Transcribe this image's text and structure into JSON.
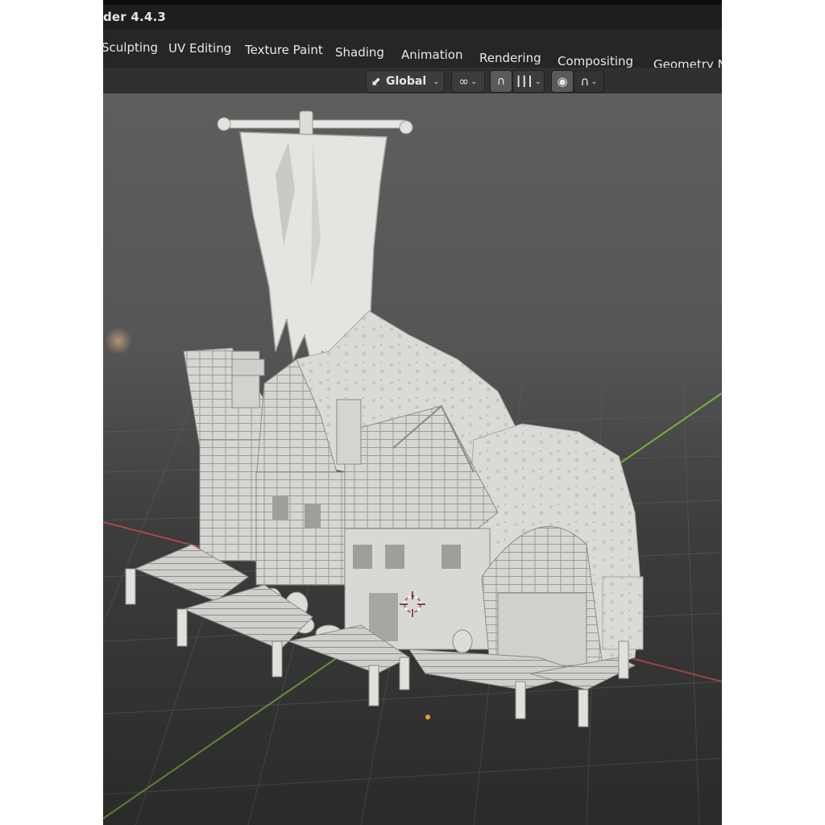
{
  "app": {
    "title": "der 4.4.3"
  },
  "workspace_tabs": [
    {
      "label": "Sculpting"
    },
    {
      "label": "UV Editing"
    },
    {
      "label": "Texture Paint"
    },
    {
      "label": "Shading"
    },
    {
      "label": "Animation"
    },
    {
      "label": "Rendering"
    },
    {
      "label": "Compositing"
    },
    {
      "label": "Geometry N"
    }
  ],
  "toolbar": {
    "transform_orientation": "Global",
    "transform_orientation_icon": "orientation-axes-icon",
    "pivot_icon": "pivot-link-icon",
    "snap_icon": "snap-magnet-icon",
    "snap_target_icon": "snap-increment-icon",
    "proportional_icon": "proportional-edit-icon",
    "falloff_icon": "falloff-curve-icon"
  },
  "viewport": {
    "object": "medieval-harbor-town-sculpt",
    "axis_colors": {
      "x": "#c04a52",
      "y": "#7bb33a"
    },
    "cursor_icon": "3d-cursor-icon",
    "origin_dot_color": "#f0a020"
  }
}
